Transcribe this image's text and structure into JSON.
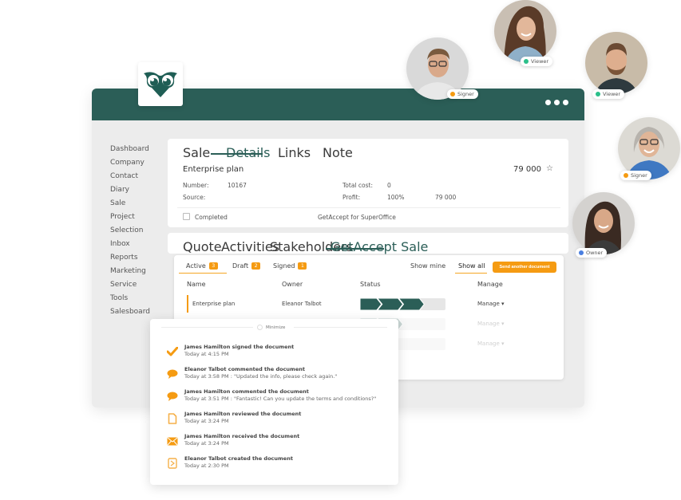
{
  "colors": {
    "brand": "#2b5e57",
    "accent": "#f59b12",
    "signer": "#f59b12",
    "viewer": "#2bbf8a",
    "owner": "#4a7fe0"
  },
  "header": {
    "logo_icon": "owl-logo-icon",
    "more_icon": "more-dots-icon"
  },
  "sidebar": {
    "items": [
      {
        "label": "Dashboard"
      },
      {
        "label": "Company"
      },
      {
        "label": "Contact"
      },
      {
        "label": "Diary"
      },
      {
        "label": "Sale"
      },
      {
        "label": "Project"
      },
      {
        "label": "Selection"
      },
      {
        "label": "Inbox"
      },
      {
        "label": "Reports"
      },
      {
        "label": "Marketing"
      },
      {
        "label": "Service"
      },
      {
        "label": "Tools"
      },
      {
        "label": "Salesboard"
      }
    ]
  },
  "details": {
    "tabs": [
      {
        "label": "Sale"
      },
      {
        "label": "Details",
        "active": true
      },
      {
        "label": "Links"
      },
      {
        "label": "Note"
      }
    ],
    "title": "Enterprise plan",
    "amount": "79 000",
    "star_icon": "star-icon",
    "number_label": "Number:",
    "number_value": "10167",
    "source_label": "Source:",
    "source_value": "",
    "total_cost_label": "Total cost:",
    "total_cost_value": "0",
    "profit_label": "Profit:",
    "profit_percent": "100%",
    "profit_value": "79 000",
    "completed_label": "Completed",
    "completed_checked": false,
    "integration_label": "GetAccept for SuperOffice"
  },
  "subtabs": [
    {
      "label": "Quote"
    },
    {
      "label": "Activities"
    },
    {
      "label": "Stakeholders"
    },
    {
      "label": "GetAccept Sale",
      "active": true
    }
  ],
  "documents": {
    "filters": [
      {
        "label": "Active",
        "count": "3",
        "active": true
      },
      {
        "label": "Draft",
        "count": "2"
      },
      {
        "label": "Signed",
        "count": "1"
      }
    ],
    "show_mine": "Show mine",
    "show_all": "Show all",
    "send_button": "Send another document",
    "columns": {
      "name": "Name",
      "owner": "Owner",
      "status": "Status",
      "manage": "Manage"
    },
    "rows": [
      {
        "name": "Enterprise plan",
        "owner": "Eleanor Talbot",
        "status_steps_done": 3,
        "status_steps_total": 4,
        "manage": "Manage"
      },
      {
        "name": "",
        "owner": "",
        "status_steps_done": 2,
        "status_steps_total": 4,
        "manage": "Manage"
      },
      {
        "name": "",
        "owner": "",
        "status_steps_done": 0,
        "status_steps_total": 4,
        "manage": "Manage"
      }
    ]
  },
  "activity": {
    "minimize_label": "Minimize",
    "items": [
      {
        "icon": "check-icon",
        "title": "James Hamilton signed the document",
        "sub": "Today at 4:15 PM"
      },
      {
        "icon": "comment-icon",
        "title": "Eleanor Talbot commented the document",
        "sub": "Today at 3:58 PM : \"Updated the info, please check again.\""
      },
      {
        "icon": "comment-icon",
        "title": "James Hamilton commented the document",
        "sub": "Today at 3:51 PM : \"Fantastic! Can you update the terms and conditions?\""
      },
      {
        "icon": "document-icon",
        "title": "James Hamilton reviewed the document",
        "sub": "Today at 3:24 PM"
      },
      {
        "icon": "envelope-icon",
        "title": "James Hamilton received the document",
        "sub": "Today at 3:24 PM"
      },
      {
        "icon": "pdf-file-icon",
        "title": "Eleanor Talbot created the document",
        "sub": "Today at 2:30 PM"
      }
    ]
  },
  "participants": [
    {
      "role": "Signer",
      "role_color": "#f59b12"
    },
    {
      "role": "Viewer",
      "role_color": "#2bbf8a"
    },
    {
      "role": "Viewer",
      "role_color": "#2bbf8a"
    },
    {
      "role": "Signer",
      "role_color": "#f59b12"
    },
    {
      "role": "Owner",
      "role_color": "#4a7fe0"
    }
  ]
}
